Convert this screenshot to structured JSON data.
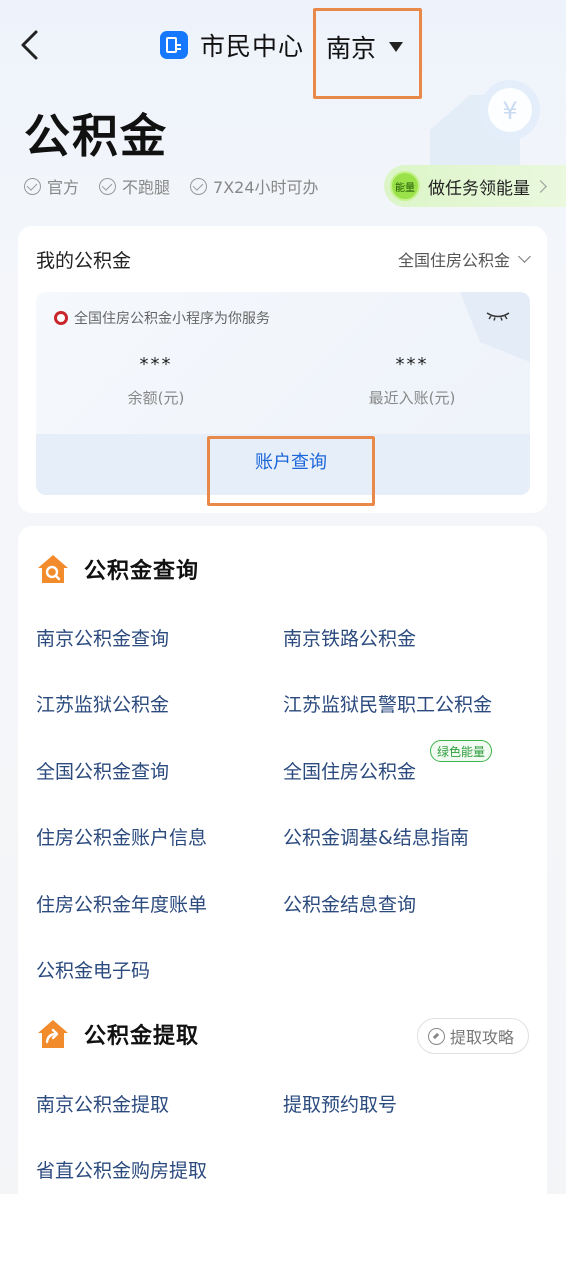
{
  "topbar": {
    "app_name": "市民中心",
    "city": "南京"
  },
  "hero": {
    "title": "公积金",
    "features": [
      "官方",
      "不跑腿",
      "7X24小时可办"
    ],
    "energy_badge": "能量",
    "energy_task": "做任务领能量"
  },
  "my_fund": {
    "title": "我的公积金",
    "selector": "全国住房公积金",
    "service_line": "全国住房公积金小程序为你服务",
    "balance_value": "***",
    "balance_label": "余额(元)",
    "recent_value": "***",
    "recent_label": "最近入账(元)",
    "query_button": "账户查询"
  },
  "query_section": {
    "title": "公积金查询",
    "links": [
      "南京公积金查询",
      "南京铁路公积金",
      "江苏监狱公积金",
      "江苏监狱民警职工公积金",
      "全国公积金查询",
      "全国住房公积金",
      "住房公积金账户信息",
      "公积金调基&结息指南",
      "住房公积金年度账单",
      "公积金结息查询",
      "公积金电子码"
    ],
    "green_tag": "绿色能量"
  },
  "withdraw_section": {
    "title": "公积金提取",
    "strategy_button": "提取攻略",
    "links": [
      "南京公积金提取",
      "提取预约取号",
      "省直公积金购房提取"
    ]
  },
  "colors": {
    "accent_blue": "#1677ff",
    "link_text": "#2b4a7e",
    "highlight_box": "#e8894a",
    "section_icon_orange": "#f28b2c",
    "energy_green": "#9be24a"
  }
}
